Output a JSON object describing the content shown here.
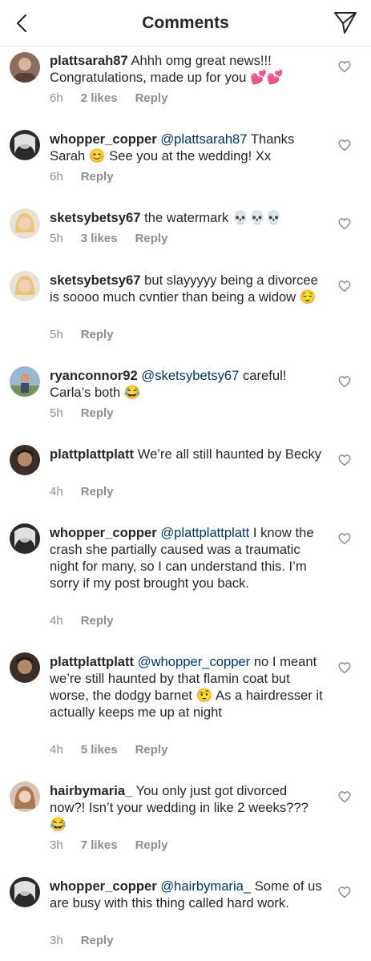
{
  "header": {
    "title": "Comments"
  },
  "icons": {
    "back": "chevron-left-icon",
    "send": "paper-plane-icon",
    "like": "heart-outline-icon"
  },
  "colors": {
    "mention": "#003569",
    "meta": "#8e8e8e",
    "text": "#262626"
  },
  "comments": [
    {
      "user": "plattsarah87",
      "mention": "",
      "text": "Ahhh omg great news!!! Congratulations, made up for you 💕💕",
      "time": "6h",
      "likes": "2 likes",
      "reply": "Reply"
    },
    {
      "user": "whopper_copper",
      "mention": "@plattsarah87",
      "text": "Thanks Sarah 😊 See you at the wedding! Xx",
      "time": "6h",
      "likes": "",
      "reply": "Reply"
    },
    {
      "user": "sketsybetsy67",
      "mention": "",
      "text": "the watermark 💀💀💀",
      "time": "5h",
      "likes": "3 likes",
      "reply": "Reply"
    },
    {
      "user": "sketsybetsy67",
      "mention": "",
      "text": "but slayyyyy being a divorcee is soooo much cvntier than being a widow 😌",
      "time": "5h",
      "likes": "",
      "reply": "Reply"
    },
    {
      "user": "ryanconnor92",
      "mention": "@sketsybetsy67",
      "text": "careful! Carla’s both 😂",
      "time": "5h",
      "likes": "",
      "reply": "Reply"
    },
    {
      "user": "plattplattplatt",
      "mention": "",
      "text": "We’re all still haunted by Becky",
      "time": "4h",
      "likes": "",
      "reply": "Reply"
    },
    {
      "user": "whopper_copper",
      "mention": "@plattplattplatt",
      "text": "I know the crash she partially caused was a traumatic night for many, so I can understand this. I’m sorry if my post brought you back.",
      "time": "4h",
      "likes": "",
      "reply": "Reply"
    },
    {
      "user": "plattplattplatt",
      "mention": "@whopper_copper",
      "text": "no I meant we’re still haunted by that flamin coat but worse, the dodgy barnet 🤨 As a hairdresser it actually keeps me up at night",
      "time": "4h",
      "likes": "5 likes",
      "reply": "Reply"
    },
    {
      "user": "hairbymaria_",
      "mention": "",
      "text": "You only just got divorced now?! Isn’t your wedding in like 2 weeks??? 😂",
      "time": "3h",
      "likes": "7 likes",
      "reply": "Reply"
    },
    {
      "user": "whopper_copper",
      "mention": "@hairbymaria_",
      "text": "Some of us are busy with this thing called hard work.",
      "time": "3h",
      "likes": "",
      "reply": "Reply"
    }
  ]
}
